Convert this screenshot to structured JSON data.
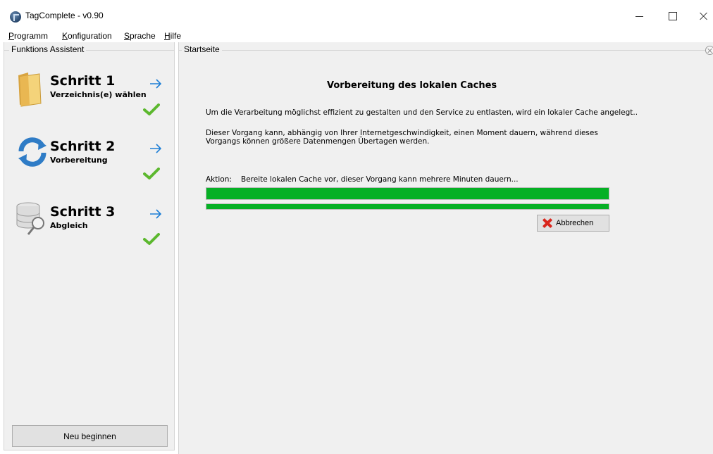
{
  "window": {
    "title": "TagComplete - v0.90"
  },
  "menu": {
    "items": [
      {
        "first": "P",
        "rest": "rogramm"
      },
      {
        "first": "K",
        "rest": "onfiguration"
      },
      {
        "first": "S",
        "rest": "prache"
      },
      {
        "first": "H",
        "rest": "ilfe"
      }
    ]
  },
  "sidebar": {
    "legend": "Funktions Assistent",
    "steps": [
      {
        "title": "Schritt 1",
        "subtitle": "Verzeichnis(e) wählen",
        "icon": "folder-icon"
      },
      {
        "title": "Schritt 2",
        "subtitle": "Vorbereitung",
        "icon": "refresh-icon"
      },
      {
        "title": "Schritt 3",
        "subtitle": "Abgleich",
        "icon": "database-search-icon"
      }
    ],
    "restart_label": "Neu beginnen"
  },
  "main": {
    "legend": "Startseite",
    "heading": "Vorbereitung des lokalen Caches",
    "para1": "Um die Verarbeitung möglichst effizient zu gestalten und den Service zu entlasten, wird ein lokaler Cache angelegt..",
    "para2_line1": "Dieser Vorgang kann, abhängig von Ihrer Internetgeschwindigkeit, einen Moment dauern, während dieses",
    "para2_line2": "Vorgangs können größere Datenmengen Übertagen werden.",
    "action_label": "Aktion:",
    "action_text": "Bereite lokalen Cache vor, dieser Vorgang kann mehrere Minuten dauern...",
    "progress1": 1.0,
    "progress2": 1.0,
    "cancel_label": "Abbrechen"
  },
  "colors": {
    "progress": "#06b025",
    "arrow": "#1e7fd6",
    "check": "#5cb82e"
  }
}
